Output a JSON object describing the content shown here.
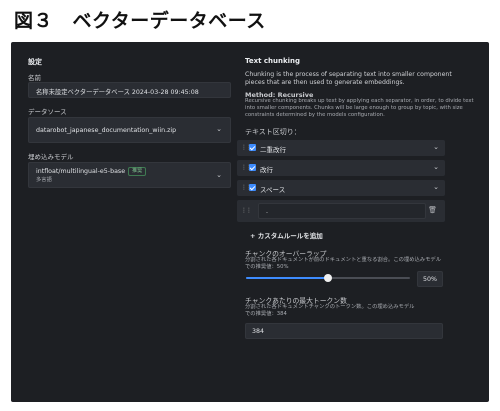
{
  "figure_title": "図３　ベクターデータベース",
  "settings": {
    "heading": "設定",
    "name_label": "名前",
    "name_value": "名称未設定ベクターデータベース 2024-03-28 09:45:08",
    "datasource_label": "データソース",
    "datasource_value": "datarobot_japanese_documentation_wiin.zip",
    "embedding_label": "埋め込みモデル",
    "embedding_value": "intfloat/multilingual-e5-base",
    "embedding_badge": "推奨",
    "embedding_sub": "多言語"
  },
  "chunking": {
    "heading": "Text chunking",
    "description": "Chunking is the process of separating text into smaller component pieces that are then used to generate embeddings.",
    "method_label": "Method: Recursive",
    "method_desc_1": "Recursive chunking breaks up text by applying each separator, in order, to divide text",
    "method_desc_2": "into smaller components. Chunks will be large enough to group by topic, with size",
    "method_desc_3": "constraints determined by the models configuration.",
    "separators_label": "テキスト区切り：",
    "separators": [
      {
        "label": "二重改行",
        "checked": true
      },
      {
        "label": "改行",
        "checked": true
      },
      {
        "label": "スペース",
        "checked": true
      }
    ],
    "custom_value": ".",
    "add_rule": "+ カスタムルールを追加",
    "overlap_label": "チャンクのオーバーラップ",
    "overlap_desc_1": "分割された各ドキュメントが前のドキュメントと重なる割合。この埋め込みモデル",
    "overlap_desc_2": "での推奨値：50%",
    "overlap_value": "50%",
    "overlap_fraction": 0.5,
    "max_tokens_label": "チャンクあたりの最大トークン数",
    "max_tokens_desc_1": "分割された各ドキュメントチャンクのトークン数。この埋め込みモデル",
    "max_tokens_desc_2": "での推奨値：384",
    "max_tokens_value": "384"
  },
  "icons": {
    "drag": "drag-handle-icon",
    "chevron": "chevron-down-icon",
    "trash": "trash-icon"
  }
}
